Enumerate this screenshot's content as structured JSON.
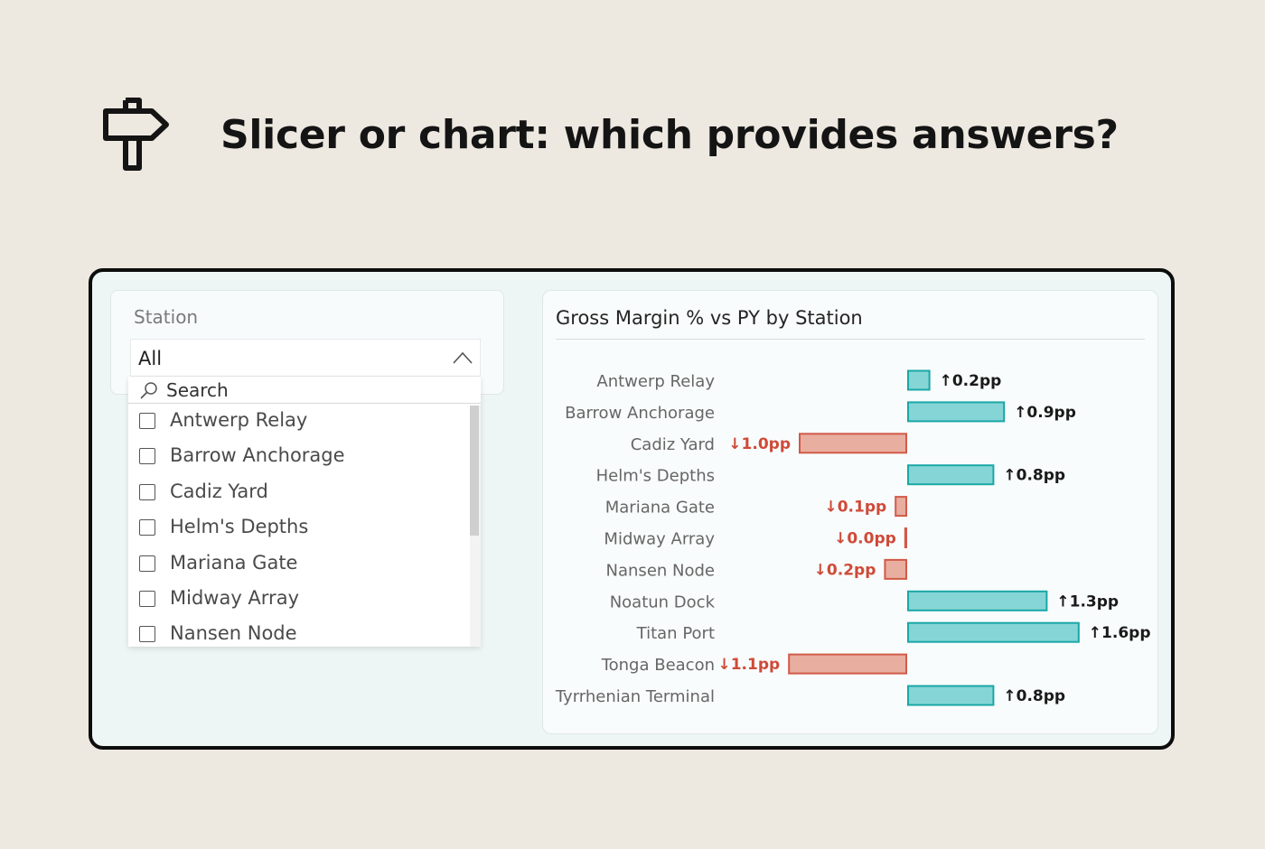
{
  "headline": {
    "text": "Slicer or chart: which provides answers?",
    "icon": "signpost-icon"
  },
  "slicer": {
    "title": "Station",
    "selected": "All",
    "search_placeholder": "Search",
    "items": [
      "Antwerp Relay",
      "Barrow Anchorage",
      "Cadiz Yard",
      "Helm's Depths",
      "Mariana Gate",
      "Midway Array",
      "Nansen Node"
    ]
  },
  "chart": {
    "title": "Gross Margin % vs PY by Station"
  },
  "chart_data": {
    "type": "bar",
    "orientation": "horizontal",
    "title": "Gross Margin % vs PY by Station",
    "categories": [
      "Antwerp Relay",
      "Barrow Anchorage",
      "Cadiz Yard",
      "Helm's Depths",
      "Mariana Gate",
      "Midway Array",
      "Nansen Node",
      "Noatun Dock",
      "Titan Port",
      "Tonga Beacon",
      "Tyrrhenian Terminal"
    ],
    "values": [
      0.2,
      0.9,
      -1.0,
      0.8,
      -0.1,
      -0.0,
      -0.2,
      1.3,
      1.6,
      -1.1,
      0.8
    ],
    "labels": [
      "↑0.2pp",
      "↑0.9pp",
      "↓1.0pp",
      "↑0.8pp",
      "↓0.1pp",
      "↓0.0pp",
      "↓0.2pp",
      "↑1.3pp",
      "↑1.6pp",
      "↓1.1pp",
      "↑0.8pp"
    ],
    "colors": {
      "positive_fill": "#86d5d6",
      "positive_stroke": "#1aa7a7",
      "negative_fill": "#e8aea0",
      "negative_stroke": "#d25a48",
      "negative_label": "#cf4a38",
      "positive_label": "#1a1a1a"
    }
  }
}
